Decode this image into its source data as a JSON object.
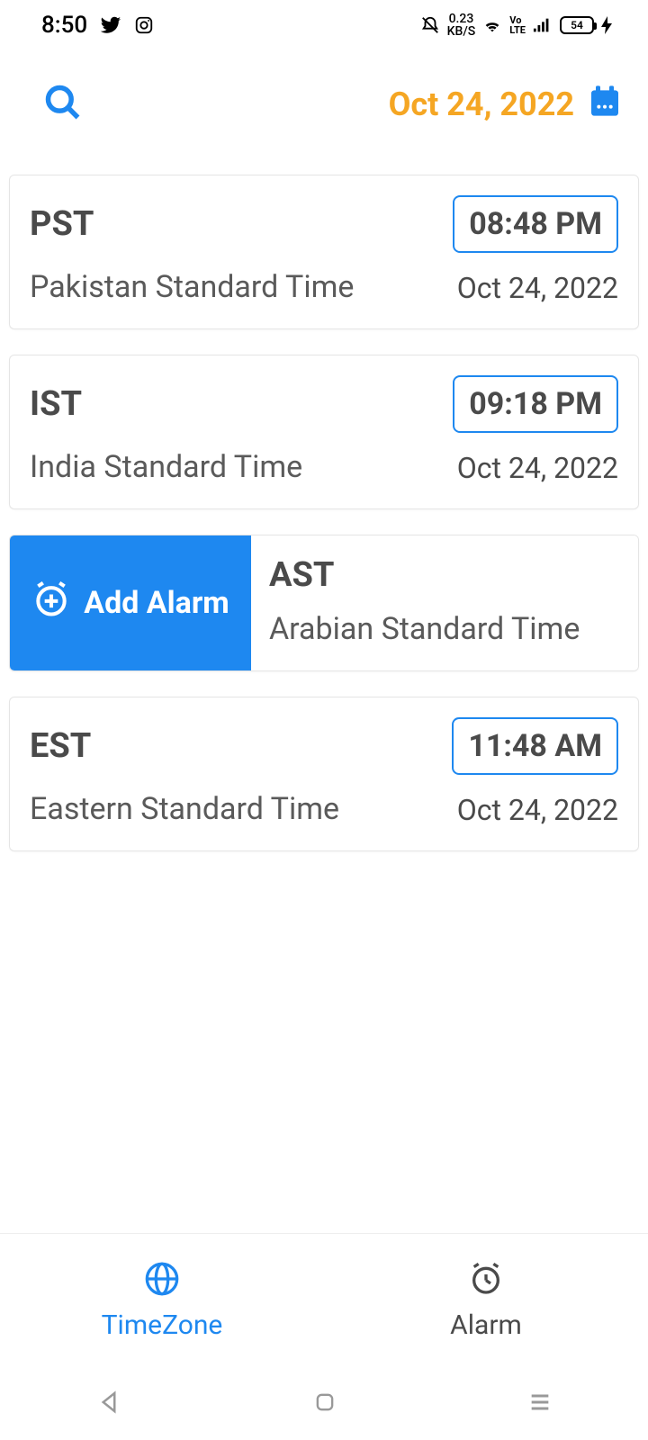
{
  "status": {
    "time": "8:50",
    "kbs_top": "0.23",
    "kbs_bot": "KB/S",
    "battery": "54"
  },
  "header": {
    "date": "Oct 24, 2022"
  },
  "cards": [
    {
      "abbr": "PST",
      "time": "08:48 PM",
      "full": "Pakistan Standard Time",
      "date": "Oct 24, 2022"
    },
    {
      "abbr": "IST",
      "time": "09:18 PM",
      "full": "India Standard Time",
      "date": "Oct 24, 2022"
    },
    {
      "abbr": "AST",
      "full": "Arabian Standard Time",
      "add_alarm_label": "Add Alarm"
    },
    {
      "abbr": "EST",
      "time": "11:48 AM",
      "full": "Eastern Standard Time",
      "date": "Oct 24, 2022"
    }
  ],
  "tabs": {
    "timezone": "TimeZone",
    "alarm": "Alarm"
  }
}
